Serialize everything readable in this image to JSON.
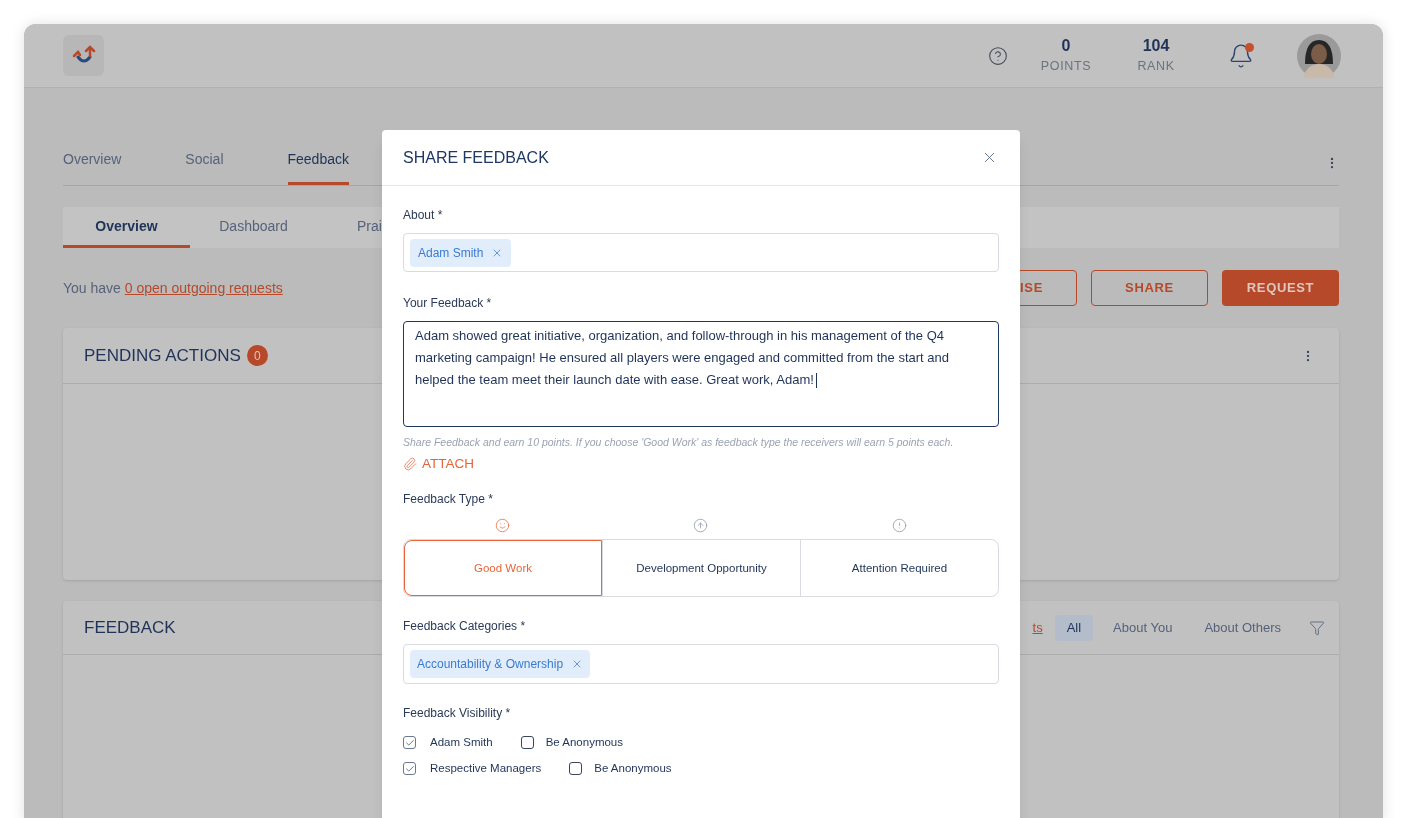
{
  "header": {
    "stats": [
      {
        "value": "0",
        "label": "POINTS"
      },
      {
        "value": "104",
        "label": "RANK"
      }
    ],
    "notification": true
  },
  "main_tabs": [
    {
      "label": "Overview",
      "selected": false
    },
    {
      "label": "Social",
      "selected": false
    },
    {
      "label": "Feedback",
      "selected": true
    }
  ],
  "sub_tabs": [
    {
      "label": "Overview",
      "selected": true
    },
    {
      "label": "Dashboard",
      "selected": false
    },
    {
      "label": "Prai",
      "selected": false
    }
  ],
  "requests_line": {
    "text": "You have",
    "link": "0 open outgoing requests"
  },
  "action_buttons": [
    {
      "label": "ISE",
      "kind": "outline"
    },
    {
      "label": "SHARE",
      "kind": "outline"
    },
    {
      "label": "REQUEST",
      "kind": "filled"
    }
  ],
  "pending_card": {
    "title": "PENDING ACTIONS",
    "count": "0"
  },
  "feedback_card": {
    "title": "FEEDBACK",
    "link": "ts",
    "filters": [
      {
        "label": "All",
        "selected": true
      },
      {
        "label": "About You",
        "selected": false
      },
      {
        "label": "About Others",
        "selected": false
      }
    ]
  },
  "modal": {
    "title": "SHARE FEEDBACK",
    "about": {
      "label": "About *",
      "tags": [
        "Adam Smith"
      ]
    },
    "feedback": {
      "label": "Your Feedback *",
      "value": "Adam showed great initiative, organization, and follow-through in his management of the Q4 marketing campaign! He ensured all players were engaged and committed from the start and helped the team meet their launch date with ease. Great work, Adam!",
      "hint": "Share Feedback and earn 10 points. If you choose 'Good Work' as feedback type the receivers will earn 5 points each.",
      "attach": "ATTACH"
    },
    "types": {
      "label": "Feedback Type *",
      "items": [
        {
          "label": "Good Work",
          "selected": true
        },
        {
          "label": "Development Opportunity",
          "selected": false
        },
        {
          "label": "Attention Required",
          "selected": false
        }
      ]
    },
    "categories": {
      "label": "Feedback Categories *",
      "tags": [
        "Accountability & Ownership"
      ]
    },
    "visibility": {
      "label": "Feedback Visibility *",
      "rows": [
        {
          "name": "Adam Smith",
          "checked": true,
          "anonymous_label": "Be Anonymous",
          "anonymous": false
        },
        {
          "name": "Respective Managers",
          "checked": true,
          "anonymous_label": "Be Anonymous",
          "anonymous": false
        }
      ]
    }
  }
}
